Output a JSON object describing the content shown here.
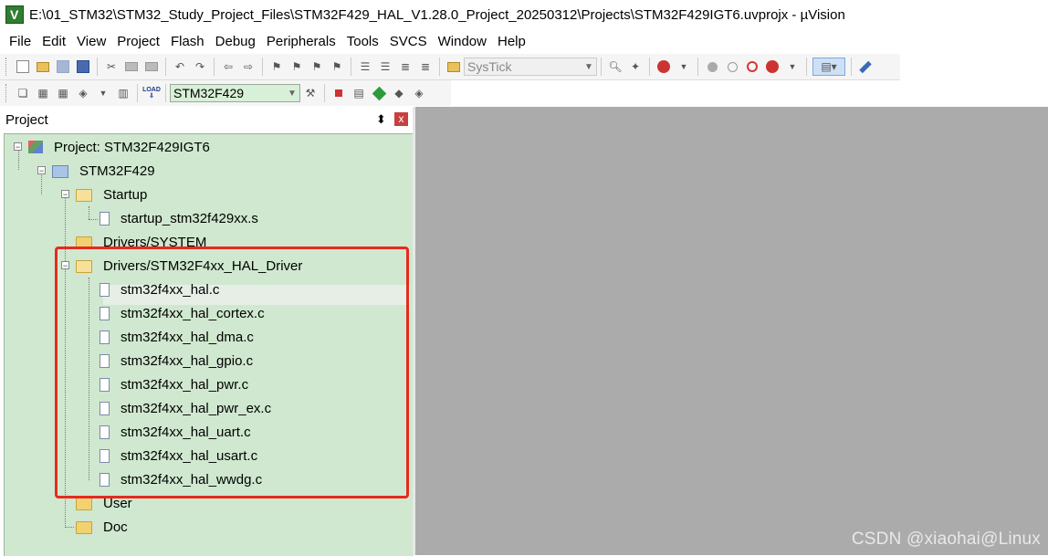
{
  "window": {
    "title": "E:\\01_STM32\\STM32_Study_Project_Files\\STM32F429_HAL_V1.28.0_Project_20250312\\Projects\\STM32F429IGT6.uvprojx - µVision"
  },
  "menu": [
    "File",
    "Edit",
    "View",
    "Project",
    "Flash",
    "Debug",
    "Peripherals",
    "Tools",
    "SVCS",
    "Window",
    "Help"
  ],
  "toolbar1": {
    "find_combo_value": "SysTick"
  },
  "toolbar2": {
    "target_combo_value": "STM32F429",
    "load_label": "LOAD"
  },
  "panel": {
    "title": "Project",
    "pin_glyph": "⬍",
    "close_glyph": "x"
  },
  "tree": {
    "project": "Project: STM32F429IGT6",
    "target": "STM32F429",
    "groups": [
      {
        "name": "Startup",
        "files": [
          "startup_stm32f429xx.s"
        ]
      },
      {
        "name": "Drivers/SYSTEM",
        "files": []
      },
      {
        "name": "Drivers/STM32F4xx_HAL_Driver",
        "files": [
          "stm32f4xx_hal.c",
          "stm32f4xx_hal_cortex.c",
          "stm32f4xx_hal_dma.c",
          "stm32f4xx_hal_gpio.c",
          "stm32f4xx_hal_pwr.c",
          "stm32f4xx_hal_pwr_ex.c",
          "stm32f4xx_hal_uart.c",
          "stm32f4xx_hal_usart.c",
          "stm32f4xx_hal_wwdg.c"
        ]
      },
      {
        "name": "User",
        "files": []
      },
      {
        "name": "Doc",
        "files": []
      }
    ]
  },
  "watermark": "CSDN @xiaohai@Linux",
  "colors": {
    "tree_background": "#cfe8cf",
    "workspace_background": "#ababab",
    "highlight_border": "#e52b1f"
  }
}
